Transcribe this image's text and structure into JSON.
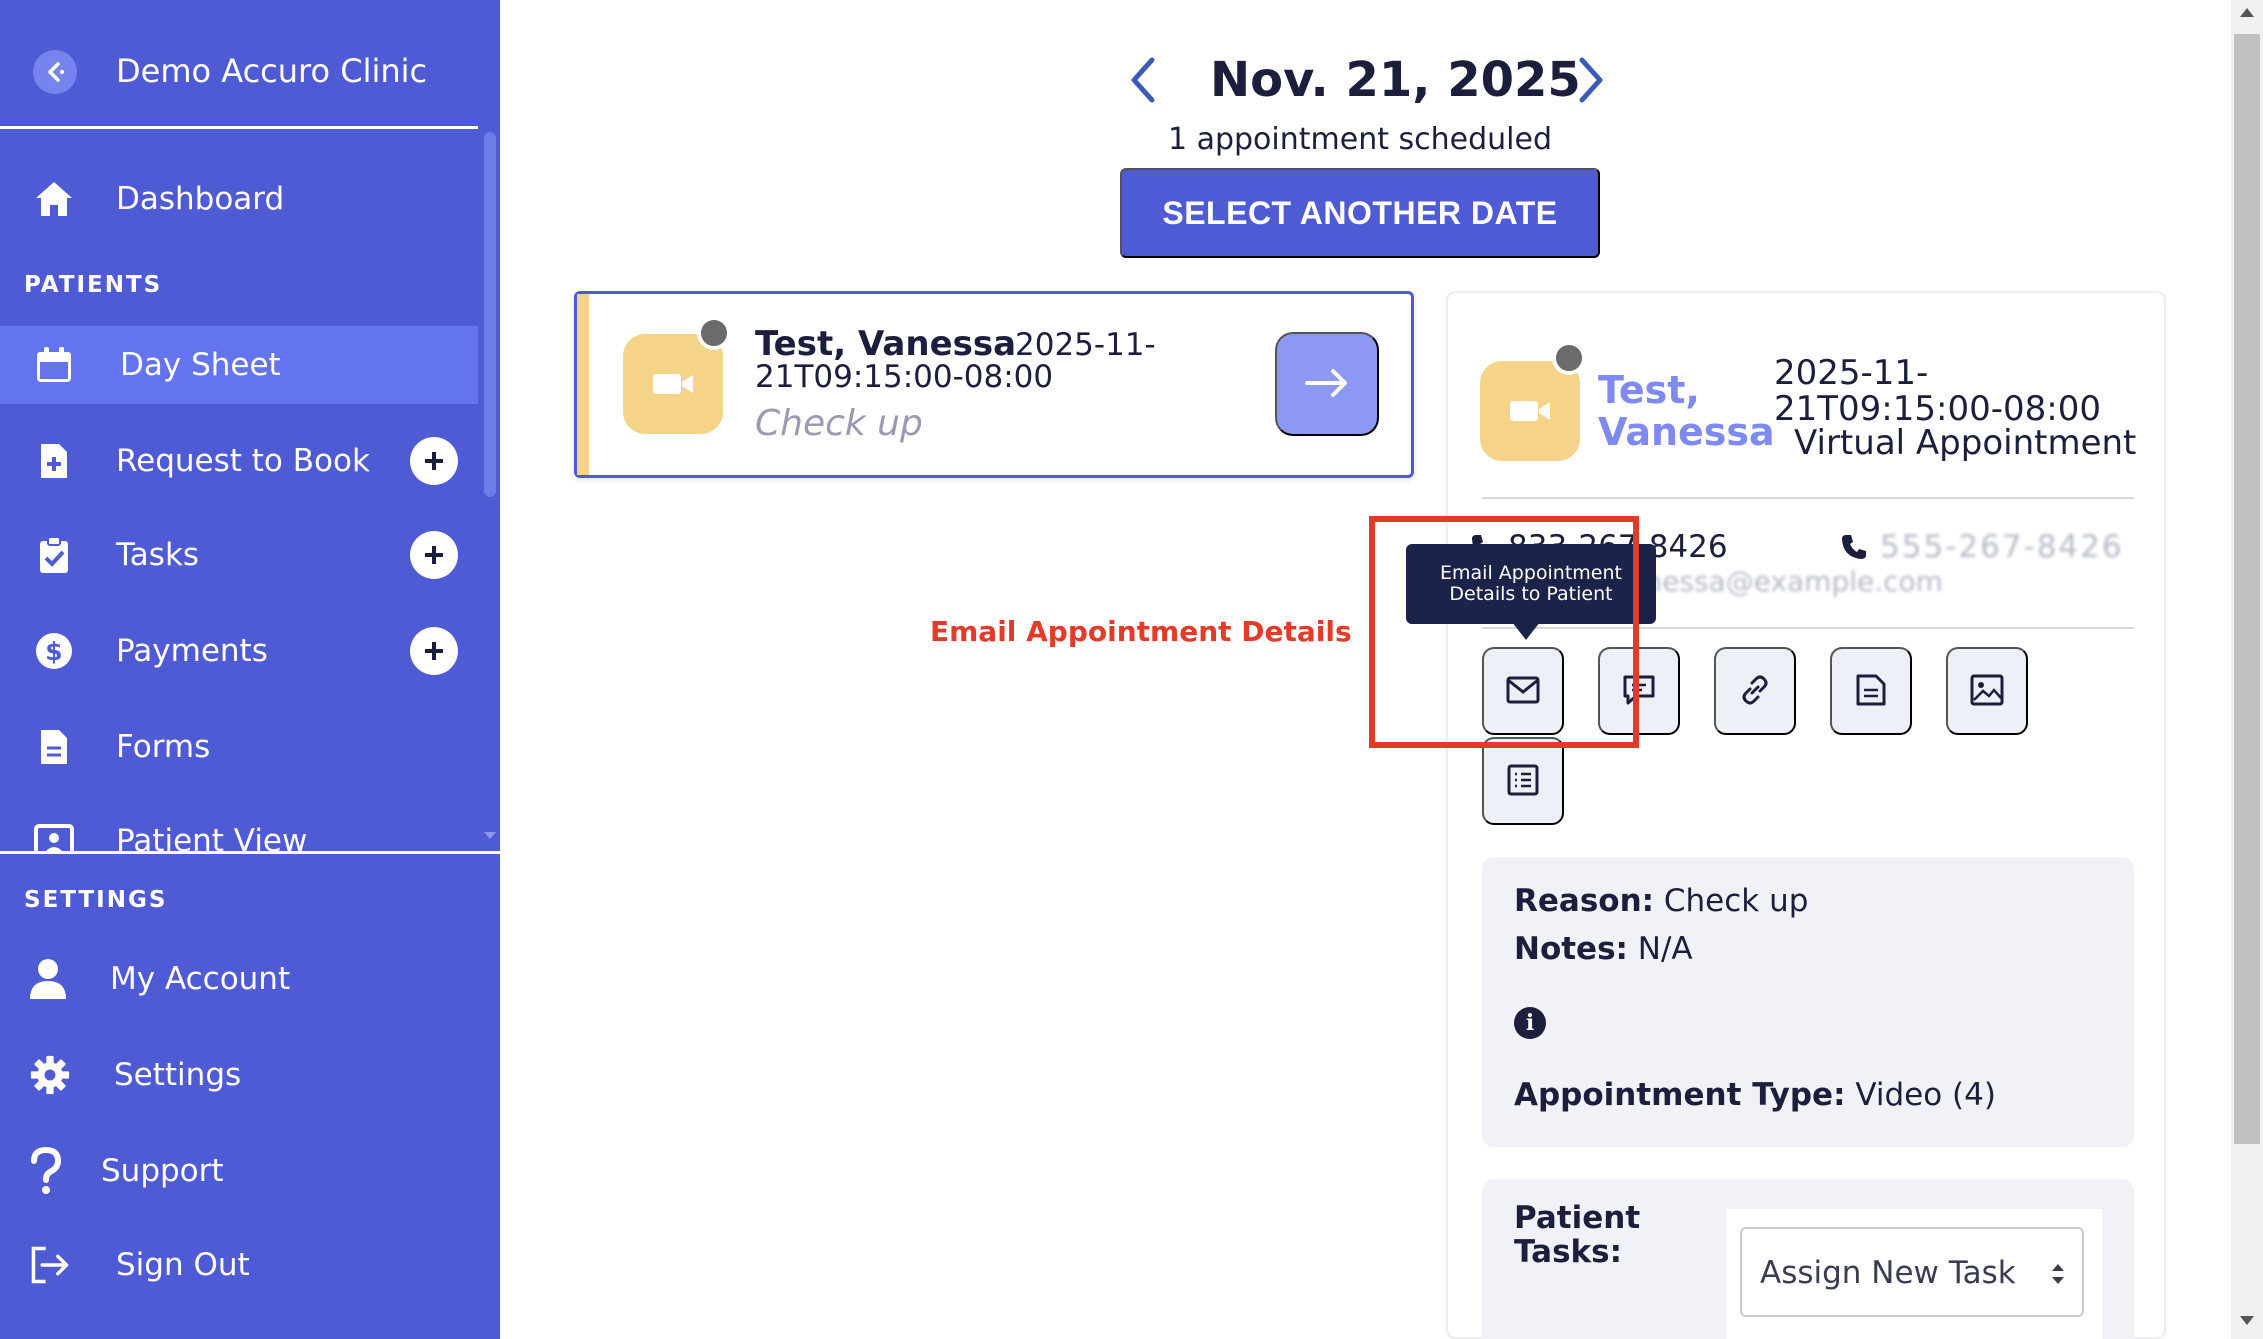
{
  "sidebar": {
    "clinic_name": "Demo Accuro Clinic",
    "items": [
      {
        "label": "Dashboard",
        "icon": "home-icon"
      },
      {
        "label": "Day Sheet",
        "icon": "calendar-icon",
        "active": true
      },
      {
        "label": "Request to Book",
        "icon": "file-plus-icon",
        "has_add": true
      },
      {
        "label": "Tasks",
        "icon": "clipboard-check-icon",
        "has_add": true
      },
      {
        "label": "Payments",
        "icon": "dollar-icon",
        "has_add": true
      },
      {
        "label": "Forms",
        "icon": "document-icon"
      },
      {
        "label": "Patient View",
        "icon": "id-card-icon"
      }
    ],
    "patients_label": "PATIENTS",
    "settings_label": "SETTINGS",
    "settings_items": [
      {
        "label": "My Account",
        "icon": "user-icon"
      },
      {
        "label": "Settings",
        "icon": "gear-icon"
      },
      {
        "label": "Support",
        "icon": "question-icon"
      },
      {
        "label": "Sign Out",
        "icon": "sign-out-icon"
      }
    ]
  },
  "header": {
    "date": "Nov. 21, 2025",
    "appointment_count": "1 appointment scheduled",
    "select_date_label": "SELECT ANOTHER DATE"
  },
  "appointment_card": {
    "patient_name": "Test, Vanessa",
    "datetime_part1": "2025-11-",
    "datetime_part2": "21T09:15:00-08:00",
    "reason": "Check up"
  },
  "annotation": {
    "label": "Email Appointment Details"
  },
  "details": {
    "name_line1": "Test,",
    "name_line2": "Vanessa",
    "datetime_line1": "2025-11-",
    "datetime_line2": "21T09:15:00-08:00",
    "appointment_kind": "Virtual Appointment",
    "phone1": "833-267-8426",
    "phone2": "555-267-8426",
    "email": "test.vanessa@example.com",
    "tooltip": "Email Appointment Details to Patient",
    "actions": [
      "email-icon",
      "chat-icon",
      "link-icon",
      "document-icon",
      "image-icon",
      "list-icon"
    ],
    "reason_label": "Reason:",
    "reason_value": "Check up",
    "notes_label": "Notes:",
    "notes_value": "N/A",
    "appt_type_label": "Appointment Type:",
    "appt_type_value": "Video (4)",
    "tasks_label_line1": "Patient",
    "tasks_label_line2": "Tasks:",
    "tasks_select_value": "Assign New Task"
  },
  "colors": {
    "sidebar_bg": "#4f5bd5",
    "sidebar_active": "#6474ee",
    "accent": "#4f5bd5",
    "camera_tile": "#f5d48a",
    "annotation_red": "#e23b2a",
    "tooltip_bg": "#1b234a"
  }
}
